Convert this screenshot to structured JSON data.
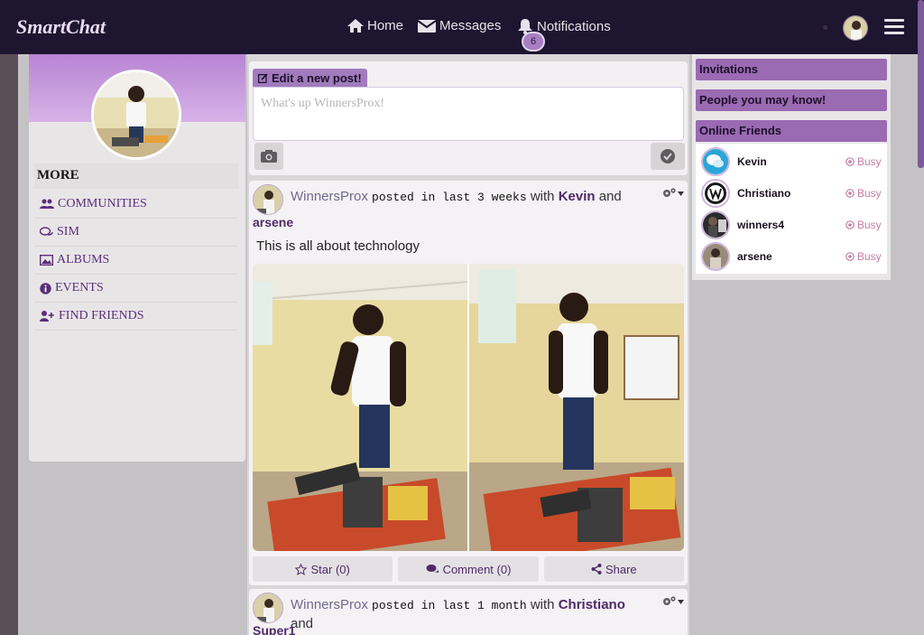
{
  "navbar": {
    "brand": "SmartChat",
    "home_label": "Home",
    "messages_label": "Messages",
    "notifications_label": "Notifications",
    "notifications_count": "6"
  },
  "sidebar": {
    "more_heading": "MORE",
    "items": [
      {
        "label": "COMMUNITIES",
        "icon": "users-icon"
      },
      {
        "label": "SIM",
        "icon": "comments-icon"
      },
      {
        "label": "ALBUMS",
        "icon": "picture-icon"
      },
      {
        "label": "EVENTS",
        "icon": "info-icon"
      },
      {
        "label": "FIND FRIENDS",
        "icon": "user-plus-icon"
      }
    ]
  },
  "composer": {
    "tab_label": "Edit a new post!",
    "placeholder": "What's up WinnersProx!"
  },
  "posts": [
    {
      "author": "WinnersProx",
      "verb": "posted in last 3 weeks",
      "with_label": "with",
      "tag1": "Kevin",
      "and_label": "and",
      "tag2": "arsene",
      "text": "This is all about technology",
      "star_label": "Star (0)",
      "comment_label": "Comment (0)",
      "share_label": "Share"
    },
    {
      "author": "WinnersProx",
      "verb": "posted in last 1 month",
      "with_label": "with",
      "tag1": "Christiano",
      "and_label": "and",
      "tag2": "Super1"
    }
  ],
  "right": {
    "invitations": "Invitations",
    "people": "People you may know!",
    "online": "Online Friends",
    "friends": [
      {
        "name": "Kevin",
        "status": "Busy"
      },
      {
        "name": "Christiano",
        "status": "Busy"
      },
      {
        "name": "winners4",
        "status": "Busy"
      },
      {
        "name": "arsene",
        "status": "Busy"
      }
    ]
  },
  "colors": {
    "navbar": "#1e1530",
    "accent": "#9a6ab2",
    "busy": "#c57ea5"
  }
}
